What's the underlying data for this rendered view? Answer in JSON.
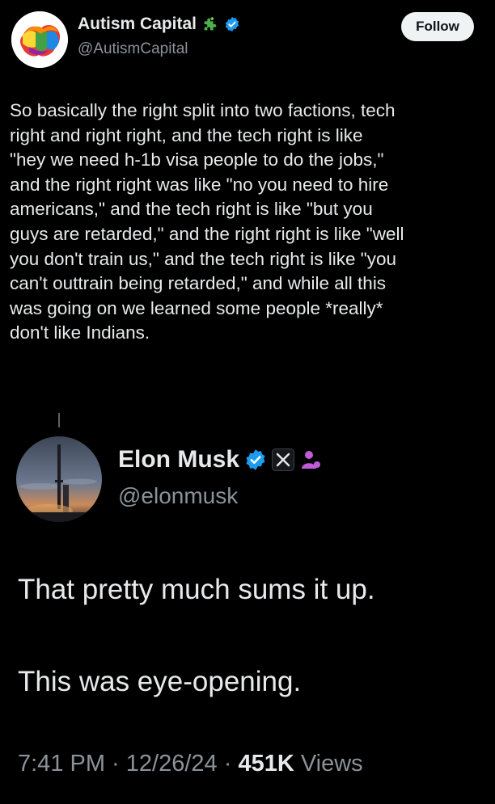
{
  "quoted_tweet": {
    "author_name": "Autism Capital",
    "author_handle": "@AutismCapital",
    "follow_label": "Follow",
    "body_lines": [
      "So basically the right split into two factions, tech",
      "right and right right, and the tech right is like",
      "\"hey we need h-1b visa people to do the jobs,\"",
      "and the right right was like \"no you need to hire",
      "americans,\" and the tech right is like  \"but you",
      "guys are retarded,\" and the right right is like \"well",
      "you don't train us,\" and the tech right is like \"you",
      "can't outtrain being retarded,\" and while all this",
      "was going on we learned some people *really*",
      "don't like Indians."
    ],
    "icons": [
      "puzzle-icon",
      "verified-badge-icon"
    ]
  },
  "main_tweet": {
    "author_name": "Elon Musk",
    "author_handle": "@elonmusk",
    "text_line1": "That pretty much sums it up.",
    "text_line2": "This was eye-opening.",
    "time": "7:41 PM",
    "separator": " · ",
    "date": "12/26/24",
    "views_count": "451K",
    "views_label": " Views",
    "icons": [
      "verified-badge-icon",
      "x-logo-icon",
      "person-icon"
    ]
  },
  "colors": {
    "background": "#000000",
    "text": "#e7e9ea",
    "secondary_text": "#8b9299",
    "verified_blue": "#1d9bf0",
    "follow_button_bg": "#eff3f4",
    "puzzle_green": "#4fae4b",
    "person_purple": "#c05bd6"
  }
}
